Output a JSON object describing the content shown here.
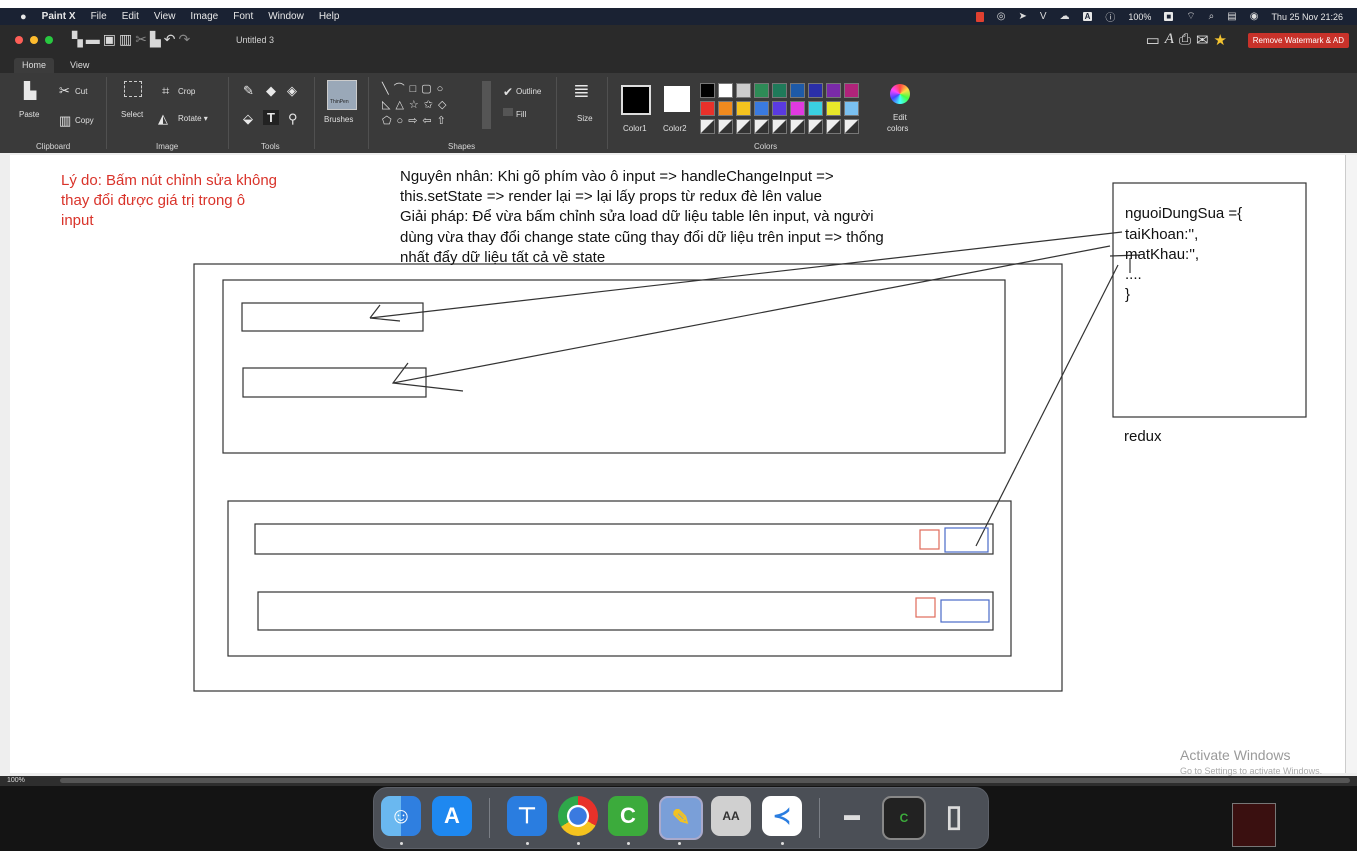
{
  "menubar": {
    "apple": "",
    "app_name": "Paint X",
    "items": [
      "File",
      "Edit",
      "View",
      "Image",
      "Font",
      "Window",
      "Help"
    ],
    "battery": "100%",
    "datetime": "Thu 25 Nov  21:26"
  },
  "window": {
    "title": "Untitled 3",
    "remove_watermark": "Remove Watermark & AD"
  },
  "tabs": [
    "Home",
    "View"
  ],
  "ribbon": {
    "clipboard": {
      "group": "Clipboard",
      "paste": "Paste",
      "cut": "Cut",
      "copy": "Copy"
    },
    "image": {
      "group": "Image",
      "select": "Select",
      "crop": "Crop",
      "rotate": "Rotate ▾"
    },
    "tools": {
      "group": "Tools"
    },
    "brushes": {
      "label": "Brushes",
      "thumb": "ThinPen"
    },
    "shapes": {
      "group": "Shapes",
      "outline": "Outline",
      "fill": "Fill"
    },
    "size": {
      "label": "Size"
    },
    "colors": {
      "group": "Colors",
      "color1": "Color1",
      "color2": "Color2",
      "edit_colors_line1": "Edit",
      "edit_colors_line2": "colors",
      "row1": [
        "#000000",
        "#ffffff",
        "#cccccc",
        "#2e8b57",
        "#1f7a5a",
        "#1e5aa8",
        "#2b2fa8",
        "#7a2aa8",
        "#b0237a"
      ],
      "row2": [
        "#e8312a",
        "#f08a1e",
        "#f5c31e",
        "#3a7ae0",
        "#5a3ae0",
        "#e03ae0",
        "#3ad0e0",
        "#e8e82a",
        "#7ac0f0"
      ]
    }
  },
  "canvas_text": {
    "reason_line1": "Lý do: Bấm nút chỉnh sửa không",
    "reason_line2": "thay đổi được giá trị trong ô",
    "reason_line3": "input",
    "cause_line1": "Nguyên nhân: Khi gõ phím vào ô input => handleChangeInput =>",
    "cause_line2": "this.setState => render lại => lại lấy props từ redux đè lên value",
    "solution_line1": "Giải pháp: Để vừa bấm chỉnh sửa load dữ liệu table lên input, và người",
    "solution_line2": "dùng vừa thay đổi change state cũng thay đổi dữ liệu trên input => thống",
    "solution_line3": "nhất đẩy dữ liệu tất cả về state",
    "code_line1": "nguoiDungSua ={",
    "code_line2": "taiKhoan:'',",
    "code_line3": "matKhau:'',",
    "code_line4": "....",
    "code_line5": "}",
    "redux_label": "redux"
  },
  "status": {
    "zoom": "100%"
  },
  "activate": {
    "title": "Activate Windows",
    "subtitle": "Go to Settings to activate Windows."
  },
  "dock": {
    "apps": [
      "finder-icon",
      "app-store-icon",
      "keynote-icon",
      "chrome-icon",
      "camtasia-icon",
      "preview-icon",
      "font-book-icon",
      "vscode-icon"
    ]
  }
}
